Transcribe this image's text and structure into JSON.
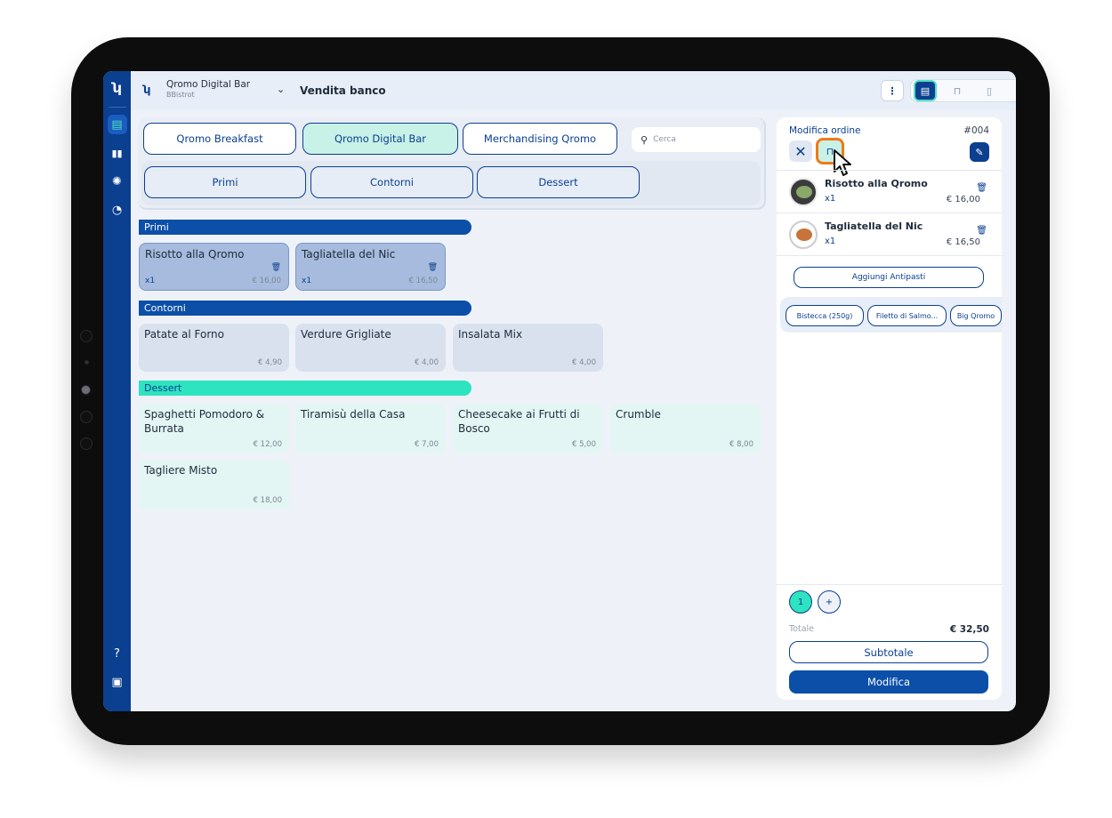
{
  "header": {
    "venue_name": "Qromo Digital Bar",
    "venue_sub": "BBistrot",
    "page_title": "Vendita banco"
  },
  "menus": [
    {
      "label": "Qromo Breakfast",
      "active": false
    },
    {
      "label": "Qromo Digital Bar",
      "active": true
    },
    {
      "label": "Merchandising Qromo",
      "active": false
    }
  ],
  "search": {
    "placeholder": "Cerca"
  },
  "categories": [
    "Primi",
    "Contorni",
    "Dessert"
  ],
  "sections": {
    "primi": {
      "title": "Primi",
      "items": [
        {
          "name": "Risotto alla Qromo",
          "price": "€ 16,00",
          "qty": "x1"
        },
        {
          "name": "Tagliatella del Nic",
          "price": "€ 16,50",
          "qty": "x1"
        }
      ]
    },
    "contorni": {
      "title": "Contorni",
      "items": [
        {
          "name": "Patate al Forno",
          "price": "€ 4,90"
        },
        {
          "name": "Verdure Grigliate",
          "price": "€ 4,00"
        },
        {
          "name": "Insalata Mix",
          "price": "€ 4,00"
        }
      ]
    },
    "dessert": {
      "title": "Dessert",
      "items": [
        {
          "name": "Spaghetti Pomodoro & Burrata",
          "price": "€ 12,00"
        },
        {
          "name": "Tiramisù della Casa",
          "price": "€ 7,00"
        },
        {
          "name": "Cheesecake ai Frutti di Bosco",
          "price": "€ 5,00"
        },
        {
          "name": "Crumble",
          "price": "€ 8,00"
        },
        {
          "name": "Tagliere Misto",
          "price": "€ 18,00"
        }
      ]
    }
  },
  "order": {
    "title": "Modifica ordine",
    "number": "#004",
    "lines": [
      {
        "name": "Risotto alla Qromo",
        "qty": "x1",
        "price": "€ 16,00"
      },
      {
        "name": "Tagliatella del Nic",
        "qty": "x1",
        "price": "€ 16,50"
      }
    ],
    "add_button": "Aggiungi Antipasti",
    "suggestions": [
      "Bistecca (250g)",
      "Filetto di Salmo...",
      "Big Qromo"
    ],
    "page": "1",
    "page_add": "+",
    "total_label": "Totale",
    "total_value": "€ 32,50",
    "subtotal_button": "Subtotale",
    "confirm_button": "Modifica"
  },
  "colors": {
    "brand_blue": "#0b3f8f",
    "mint": "#2ee3c0",
    "highlight_orange": "#f07a16"
  }
}
